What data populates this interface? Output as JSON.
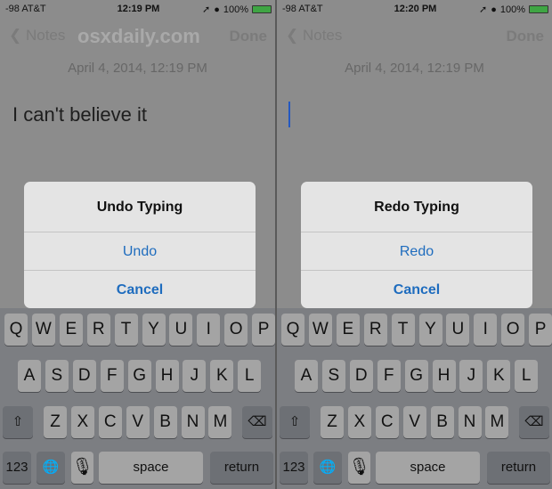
{
  "screens": [
    {
      "status": {
        "carrier": "-98 AT&T",
        "time": "12:19 PM",
        "battery": "100%"
      },
      "nav": {
        "back": "Notes",
        "done": "Done",
        "watermark": "osxdaily.com"
      },
      "date": "April 4, 2014, 12:19 PM",
      "note_text": "I can't believe it",
      "dialog": {
        "title": "Undo Typing",
        "action": "Undo",
        "cancel": "Cancel"
      }
    },
    {
      "status": {
        "carrier": "-98 AT&T",
        "time": "12:20 PM",
        "battery": "100%"
      },
      "nav": {
        "back": "Notes",
        "done": "Done"
      },
      "date": "April 4, 2014, 12:19 PM",
      "note_text": "",
      "dialog": {
        "title": "Redo Typing",
        "action": "Redo",
        "cancel": "Cancel"
      }
    }
  ],
  "keyboard": {
    "row1": [
      "Q",
      "W",
      "E",
      "R",
      "T",
      "Y",
      "U",
      "I",
      "O",
      "P"
    ],
    "row2": [
      "A",
      "S",
      "D",
      "F",
      "G",
      "H",
      "J",
      "K",
      "L"
    ],
    "row3": [
      "Z",
      "X",
      "C",
      "V",
      "B",
      "N",
      "M"
    ],
    "numbers": "123",
    "space": "space",
    "return": "return"
  },
  "colors": {
    "accent": "#1e6cbe",
    "battery": "#3fa544"
  }
}
